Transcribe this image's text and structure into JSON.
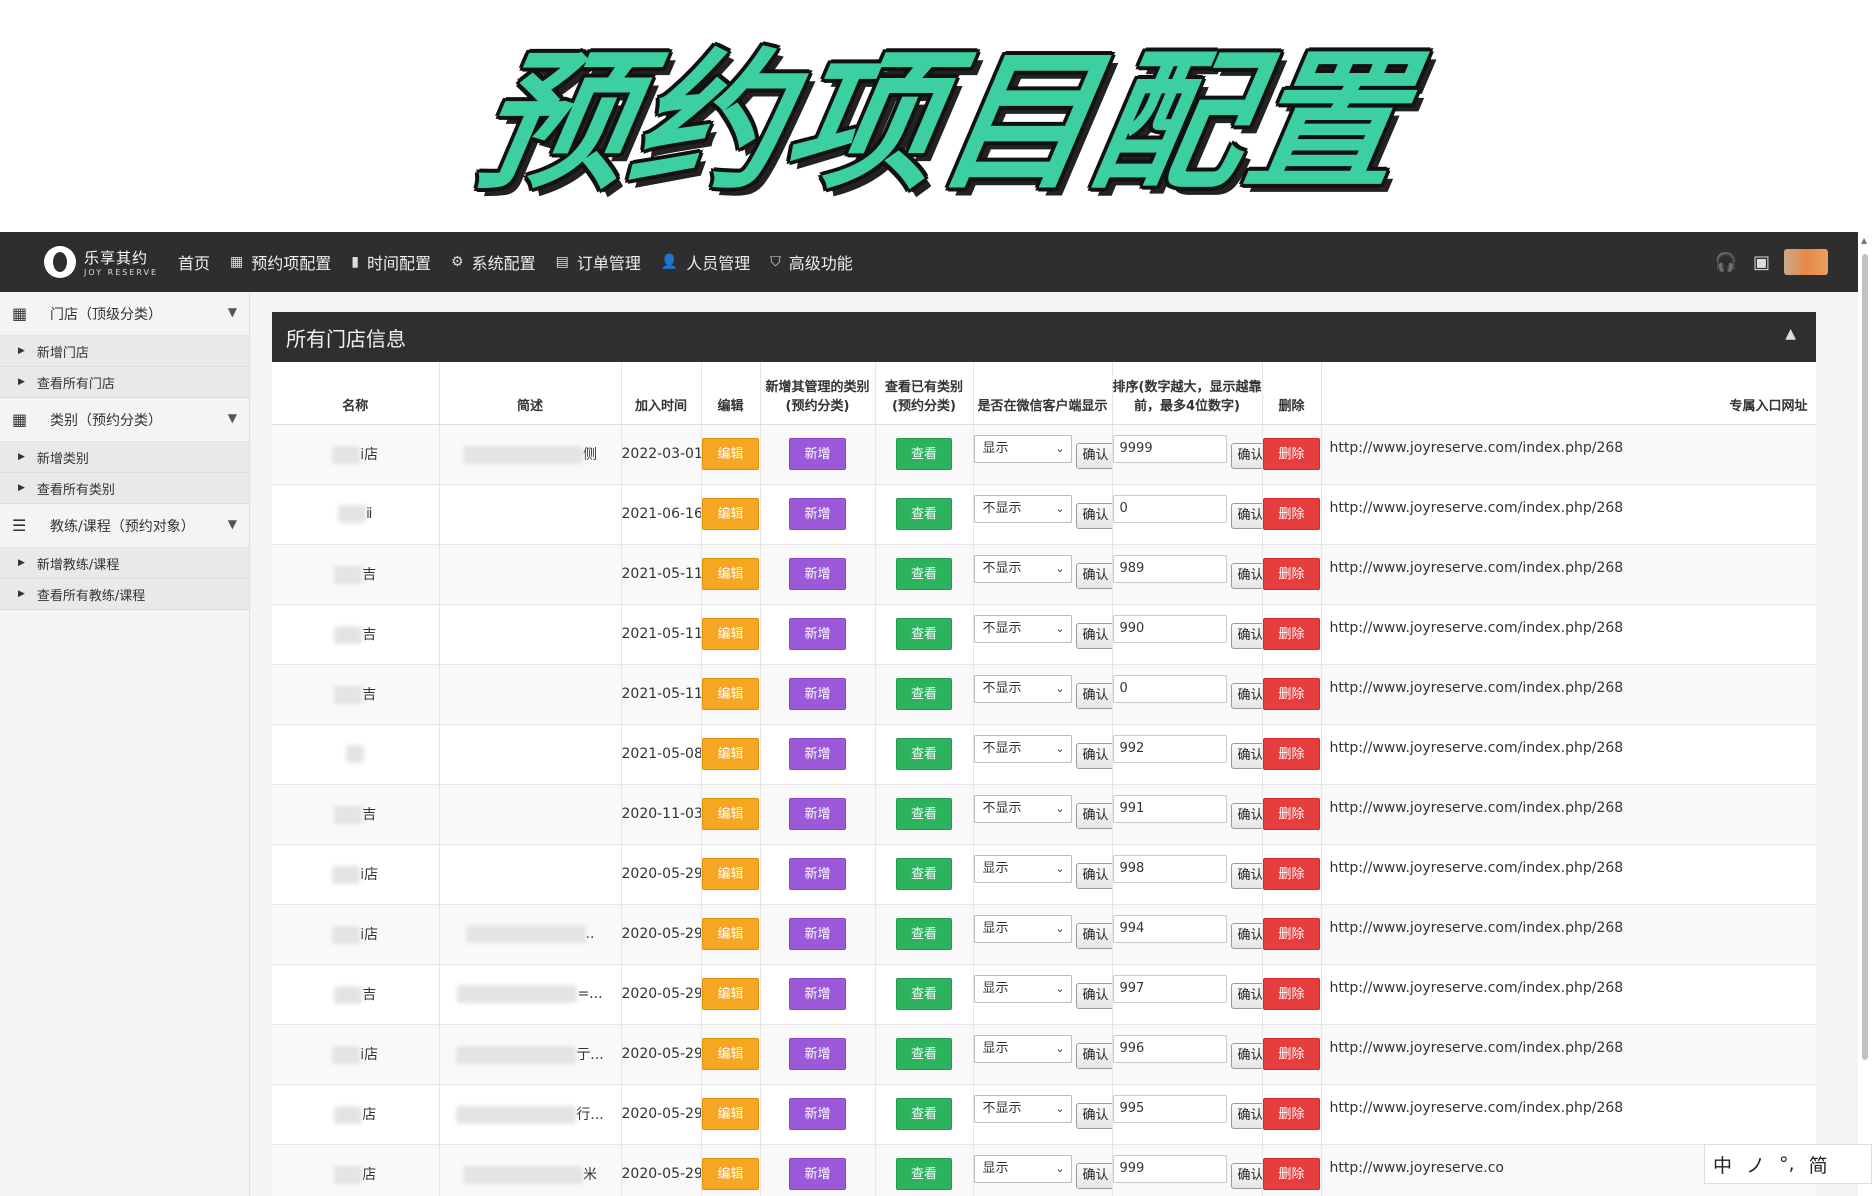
{
  "banner": {
    "title": "预约项目配置"
  },
  "topbar": {
    "logo_cn": "乐享其约",
    "logo_en": "JOY RESERVE",
    "nav": [
      {
        "label": "首页",
        "icon": ""
      },
      {
        "label": "预约项配置",
        "icon": "▦"
      },
      {
        "label": "时间配置",
        "icon": "▮"
      },
      {
        "label": "系统配置",
        "icon": "⚙"
      },
      {
        "label": "订单管理",
        "icon": "▤"
      },
      {
        "label": "人员管理",
        "icon": "👤"
      },
      {
        "label": "高级功能",
        "icon": "⛉"
      }
    ]
  },
  "sidebar": {
    "groups": [
      {
        "label": "门店（顶级分类）",
        "items": [
          "新增门店",
          "查看所有门店"
        ]
      },
      {
        "label": "类别（预约分类）",
        "items": [
          "新增类别",
          "查看所有类别"
        ]
      },
      {
        "label": "教练/课程（预约对象）",
        "items": [
          "新增教练/课程",
          "查看所有教练/课程"
        ]
      }
    ]
  },
  "panel": {
    "title": "所有门店信息",
    "headers": {
      "name": "名称",
      "desc": "简述",
      "date": "加入时间",
      "edit": "编辑",
      "add_cat_1": "新增其管理的类别",
      "add_cat_2": "(预约分类)",
      "view_cat_1": "查看已有类别",
      "view_cat_2": "(预约分类)",
      "wechat": "是否在微信客户端显示",
      "sort_1": "排序(数字越大，显示越靠",
      "sort_2": "前，最多4位数字)",
      "delete": "删除",
      "url": "专属入口网址"
    },
    "labels": {
      "edit": "编辑",
      "add": "新增",
      "view": "查看",
      "confirm": "确认",
      "delete": "删除"
    },
    "rows": [
      {
        "name": "i店",
        "desc": "侧",
        "date": "2022-03-01",
        "show": "显示",
        "sort": "9999",
        "url": "http://www.joyreserve.com/index.php/268"
      },
      {
        "name": "ⅱ",
        "desc": "",
        "date": "2021-06-16",
        "show": "不显示",
        "sort": "0",
        "url": "http://www.joyreserve.com/index.php/268"
      },
      {
        "name": "吉",
        "desc": "",
        "date": "2021-05-11",
        "show": "不显示",
        "sort": "989",
        "url": "http://www.joyreserve.com/index.php/268"
      },
      {
        "name": "吉",
        "desc": "",
        "date": "2021-05-11",
        "show": "不显示",
        "sort": "990",
        "url": "http://www.joyreserve.com/index.php/268"
      },
      {
        "name": "吉",
        "desc": "",
        "date": "2021-05-11",
        "show": "不显示",
        "sort": "0",
        "url": "http://www.joyreserve.com/index.php/268"
      },
      {
        "name": "",
        "desc": "",
        "date": "2021-05-08",
        "show": "不显示",
        "sort": "992",
        "url": "http://www.joyreserve.com/index.php/268"
      },
      {
        "name": "吉",
        "desc": "",
        "date": "2020-11-03",
        "show": "不显示",
        "sort": "991",
        "url": "http://www.joyreserve.com/index.php/268"
      },
      {
        "name": "i店",
        "desc": "",
        "date": "2020-05-29",
        "show": "显示",
        "sort": "998",
        "url": "http://www.joyreserve.com/index.php/268"
      },
      {
        "name": "i店",
        "desc": "..",
        "date": "2020-05-29",
        "show": "显示",
        "sort": "994",
        "url": "http://www.joyreserve.com/index.php/268"
      },
      {
        "name": "吉",
        "desc": "=...",
        "date": "2020-05-29",
        "show": "显示",
        "sort": "997",
        "url": "http://www.joyreserve.com/index.php/268"
      },
      {
        "name": "i店",
        "desc": "亍...",
        "date": "2020-05-29",
        "show": "显示",
        "sort": "996",
        "url": "http://www.joyreserve.com/index.php/268"
      },
      {
        "name": "店",
        "desc": "行...",
        "date": "2020-05-29",
        "show": "不显示",
        "sort": "995",
        "url": "http://www.joyreserve.com/index.php/268"
      },
      {
        "name": "店",
        "desc": "米",
        "date": "2020-05-29",
        "show": "显示",
        "sort": "999",
        "url": "http://www.joyreserve.co"
      }
    ]
  },
  "ime": {
    "items": [
      "中",
      "ノ",
      "°,",
      "简"
    ]
  },
  "colors": {
    "accent_green": "#3ccfa1",
    "edit": "#f5a623",
    "add": "#9b59d9",
    "view": "#2db35d",
    "delete": "#e63e3e",
    "header_dark": "#2e2e2e"
  }
}
